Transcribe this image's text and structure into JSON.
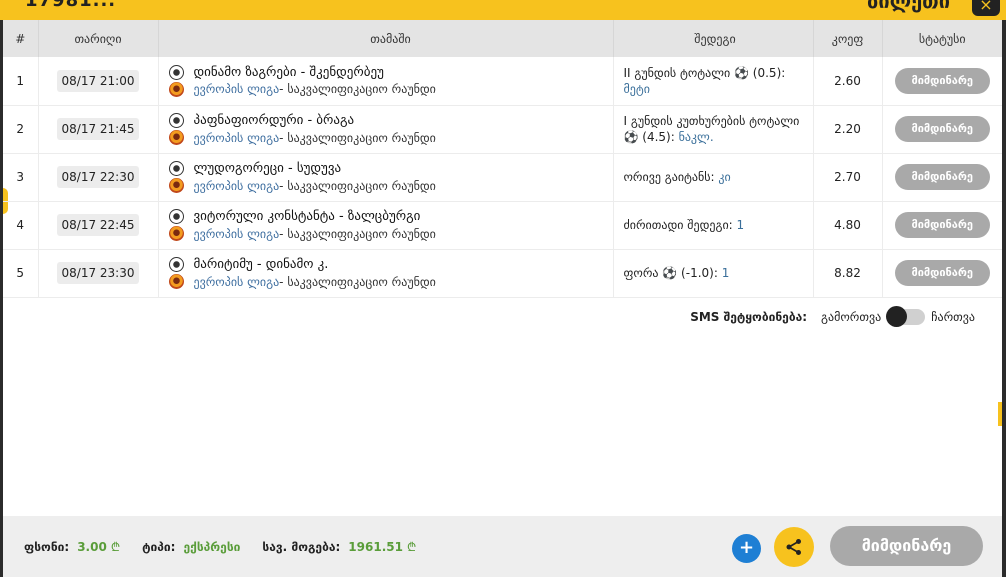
{
  "header": {
    "bet_id": "17981... ",
    "title": "ბილეთი",
    "close_label": "×"
  },
  "table": {
    "headers": [
      "#",
      "თარიღი",
      "თამაში",
      "შედეგი",
      "კოეფ",
      "სტატუსი"
    ],
    "rows": [
      {
        "num": "1",
        "date": "08/17 21:00",
        "game": "დინამო ზაგრები - შკენდერბეუ",
        "league": "ევროპის ლიგა",
        "round": " - საკვალიფიკაციო რაუნდი",
        "result": "II გუნდის ტოტალი ⚽ (0.5): ",
        "pick": "მეტი",
        "odds": "2.60",
        "status": "მიმდინარე"
      },
      {
        "num": "2",
        "date": "08/17 21:45",
        "game": "პაფნაფიორდური - ბრაგა",
        "league": "ევროპის ლიგა",
        "round": " - საკვალიფიკაციო რაუნდი",
        "result": "I გუნდის კუთხურების ტოტალი ⚽ (4.5): ",
        "pick": "ნაკლ.",
        "odds": "2.20",
        "status": "მიმდინარე"
      },
      {
        "num": "3",
        "date": "08/17 22:30",
        "game": "ლუდოგორეცი - სუდუვა",
        "league": "ევროპის ლიგა",
        "round": " - საკვალიფიკაციო რაუნდი",
        "result": "ორივე გაიტანს: ",
        "pick": "კი",
        "odds": "2.70",
        "status": "მიმდინარე"
      },
      {
        "num": "4",
        "date": "08/17 22:45",
        "game": "ვიტორული კონსტანტა - ზალცბურგი",
        "league": "ევროპის ლიგა",
        "round": " - საკვალიფიკაციო რაუნდი",
        "result": "ძირითადი შედეგი: ",
        "pick": "1",
        "odds": "4.80",
        "status": "მიმდინარე"
      },
      {
        "num": "5",
        "date": "08/17 23:30",
        "game": "მარიტიმუ - დინამო კ.",
        "league": "ევროპის ლიგა",
        "round": " - საკვალიფიკაციო რაუნდი",
        "result": "ფორა ⚽ (-1.0): ",
        "pick": "1",
        "odds": "8.82",
        "status": "მიმდინარე"
      }
    ]
  },
  "sms": {
    "label": "SMS შეტყობინება:",
    "off_label": "გამორთვა",
    "on_label": "ჩართვა"
  },
  "footer": {
    "stake_label": "ფსონი:",
    "stake_value": "3.00",
    "type_label": "ტიპი:",
    "type_value": "ექსპრესი",
    "win_label": "სავ. მოგება:",
    "win_value": "1961.51",
    "currency": "₾",
    "plus_label": "+",
    "status_label": "მიმდინარე"
  },
  "colors": {
    "accent": "#f7c21e",
    "status_grey": "#a9a9a9",
    "link_blue": "#3f6fa0",
    "value_green": "#5a9d3a",
    "plus_blue": "#1e7fd4"
  },
  "icons": [
    "soccer-ball-icon",
    "europa-league-icon",
    "share-icon",
    "close-icon",
    "plus-icon"
  ]
}
